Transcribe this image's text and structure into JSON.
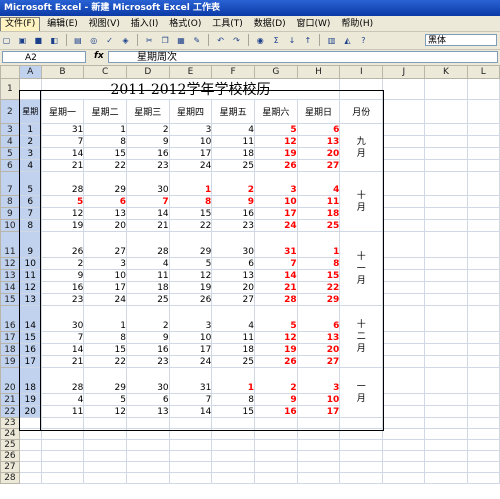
{
  "window": {
    "title": "Microsoft Excel - 新建 Microsoft Excel 工作表"
  },
  "menu": [
    "文件(F)",
    "编辑(E)",
    "视图(V)",
    "插入(I)",
    "格式(O)",
    "工具(T)",
    "数据(D)",
    "窗口(W)",
    "帮助(H)"
  ],
  "toolbar": {
    "font_name": "黑体"
  },
  "formula_bar": {
    "name_box": "A2",
    "fx": "fx",
    "content": "星期周次"
  },
  "columns": [
    "A",
    "B",
    "C",
    "D",
    "E",
    "F",
    "G",
    "H",
    "I",
    "J",
    "K",
    "L"
  ],
  "sheet": {
    "title": "2011-2012学年学校校历",
    "week_label": "星期",
    "headers": [
      "星期一",
      "星期二",
      "星期三",
      "星期四",
      "星期五",
      "星期六",
      "星期日",
      "月份"
    ],
    "rows": [
      {
        "n": "3",
        "wk": "1",
        "d": [
          "31",
          "1",
          "2",
          "3",
          "4",
          "5",
          "6"
        ]
      },
      {
        "n": "4",
        "wk": "2",
        "d": [
          "7",
          "8",
          "9",
          "10",
          "11",
          "12",
          "13"
        ]
      },
      {
        "n": "5",
        "wk": "3",
        "d": [
          "14",
          "15",
          "16",
          "17",
          "18",
          "19",
          "20"
        ]
      },
      {
        "n": "6",
        "wk": "4",
        "d": [
          "21",
          "22",
          "23",
          "24",
          "25",
          "26",
          "27"
        ]
      },
      {
        "n": "7",
        "wk": "5",
        "d": [
          "28",
          "29",
          "30",
          "1",
          "2",
          "3",
          "4"
        ]
      },
      {
        "n": "8",
        "wk": "6",
        "d": [
          "5",
          "6",
          "7",
          "8",
          "9",
          "10",
          "11"
        ]
      },
      {
        "n": "9",
        "wk": "7",
        "d": [
          "12",
          "13",
          "14",
          "15",
          "16",
          "17",
          "18"
        ]
      },
      {
        "n": "10",
        "wk": "8",
        "d": [
          "19",
          "20",
          "21",
          "22",
          "23",
          "24",
          "25"
        ]
      },
      {
        "n": "11",
        "wk": "9",
        "d": [
          "26",
          "27",
          "28",
          "29",
          "30",
          "31",
          "1"
        ]
      },
      {
        "n": "12",
        "wk": "10",
        "d": [
          "2",
          "3",
          "4",
          "5",
          "6",
          "7",
          "8"
        ]
      },
      {
        "n": "13",
        "wk": "11",
        "d": [
          "9",
          "10",
          "11",
          "12",
          "13",
          "14",
          "15"
        ]
      },
      {
        "n": "14",
        "wk": "12",
        "d": [
          "16",
          "17",
          "18",
          "19",
          "20",
          "21",
          "22"
        ]
      },
      {
        "n": "15",
        "wk": "13",
        "d": [
          "23",
          "24",
          "25",
          "26",
          "27",
          "28",
          "29"
        ]
      },
      {
        "n": "16",
        "wk": "14",
        "d": [
          "30",
          "1",
          "2",
          "3",
          "4",
          "5",
          "6"
        ]
      },
      {
        "n": "17",
        "wk": "15",
        "d": [
          "7",
          "8",
          "9",
          "10",
          "11",
          "12",
          "13"
        ]
      },
      {
        "n": "18",
        "wk": "16",
        "d": [
          "14",
          "15",
          "16",
          "17",
          "18",
          "19",
          "20"
        ]
      },
      {
        "n": "19",
        "wk": "17",
        "d": [
          "21",
          "22",
          "23",
          "24",
          "25",
          "26",
          "27"
        ]
      },
      {
        "n": "20",
        "wk": "18",
        "d": [
          "28",
          "29",
          "30",
          "31",
          "1",
          "2",
          "3"
        ]
      },
      {
        "n": "21",
        "wk": "19",
        "d": [
          "4",
          "5",
          "6",
          "7",
          "8",
          "9",
          "10"
        ]
      },
      {
        "n": "22",
        "wk": "20",
        "d": [
          "11",
          "12",
          "13",
          "14",
          "15",
          "16",
          "17"
        ]
      }
    ],
    "months": [
      {
        "at": 0,
        "label": "九月"
      },
      {
        "at": 4,
        "label": "十月"
      },
      {
        "at": 8,
        "label": "十一月"
      },
      {
        "at": 13,
        "label": "十二月"
      },
      {
        "at": 17,
        "label": "一月"
      }
    ],
    "empty_rows": [
      "23",
      "24",
      "25",
      "26",
      "27",
      "28"
    ]
  },
  "red_cells": [
    [
      0,
      5
    ],
    [
      0,
      6
    ],
    [
      1,
      5
    ],
    [
      1,
      6
    ],
    [
      2,
      5
    ],
    [
      2,
      6
    ],
    [
      3,
      5
    ],
    [
      3,
      6
    ],
    [
      4,
      3
    ],
    [
      4,
      4
    ],
    [
      4,
      5
    ],
    [
      4,
      6
    ],
    [
      5,
      0
    ],
    [
      5,
      1
    ],
    [
      5,
      2
    ],
    [
      5,
      3
    ],
    [
      5,
      4
    ],
    [
      5,
      5
    ],
    [
      5,
      6
    ],
    [
      6,
      5
    ],
    [
      6,
      6
    ],
    [
      7,
      5
    ],
    [
      7,
      6
    ],
    [
      8,
      5
    ],
    [
      8,
      6
    ],
    [
      9,
      5
    ],
    [
      9,
      6
    ],
    [
      10,
      5
    ],
    [
      10,
      6
    ],
    [
      11,
      5
    ],
    [
      11,
      6
    ],
    [
      12,
      5
    ],
    [
      12,
      6
    ],
    [
      13,
      5
    ],
    [
      13,
      6
    ],
    [
      14,
      5
    ],
    [
      14,
      6
    ],
    [
      15,
      5
    ],
    [
      15,
      6
    ],
    [
      16,
      5
    ],
    [
      16,
      6
    ],
    [
      17,
      4
    ],
    [
      17,
      5
    ],
    [
      17,
      6
    ],
    [
      18,
      5
    ],
    [
      18,
      6
    ],
    [
      19,
      5
    ],
    [
      19,
      6
    ]
  ],
  "colors": {
    "red": "#ff0000",
    "selection": "#c1d2ee",
    "titlebar": "#0a3aa6"
  }
}
